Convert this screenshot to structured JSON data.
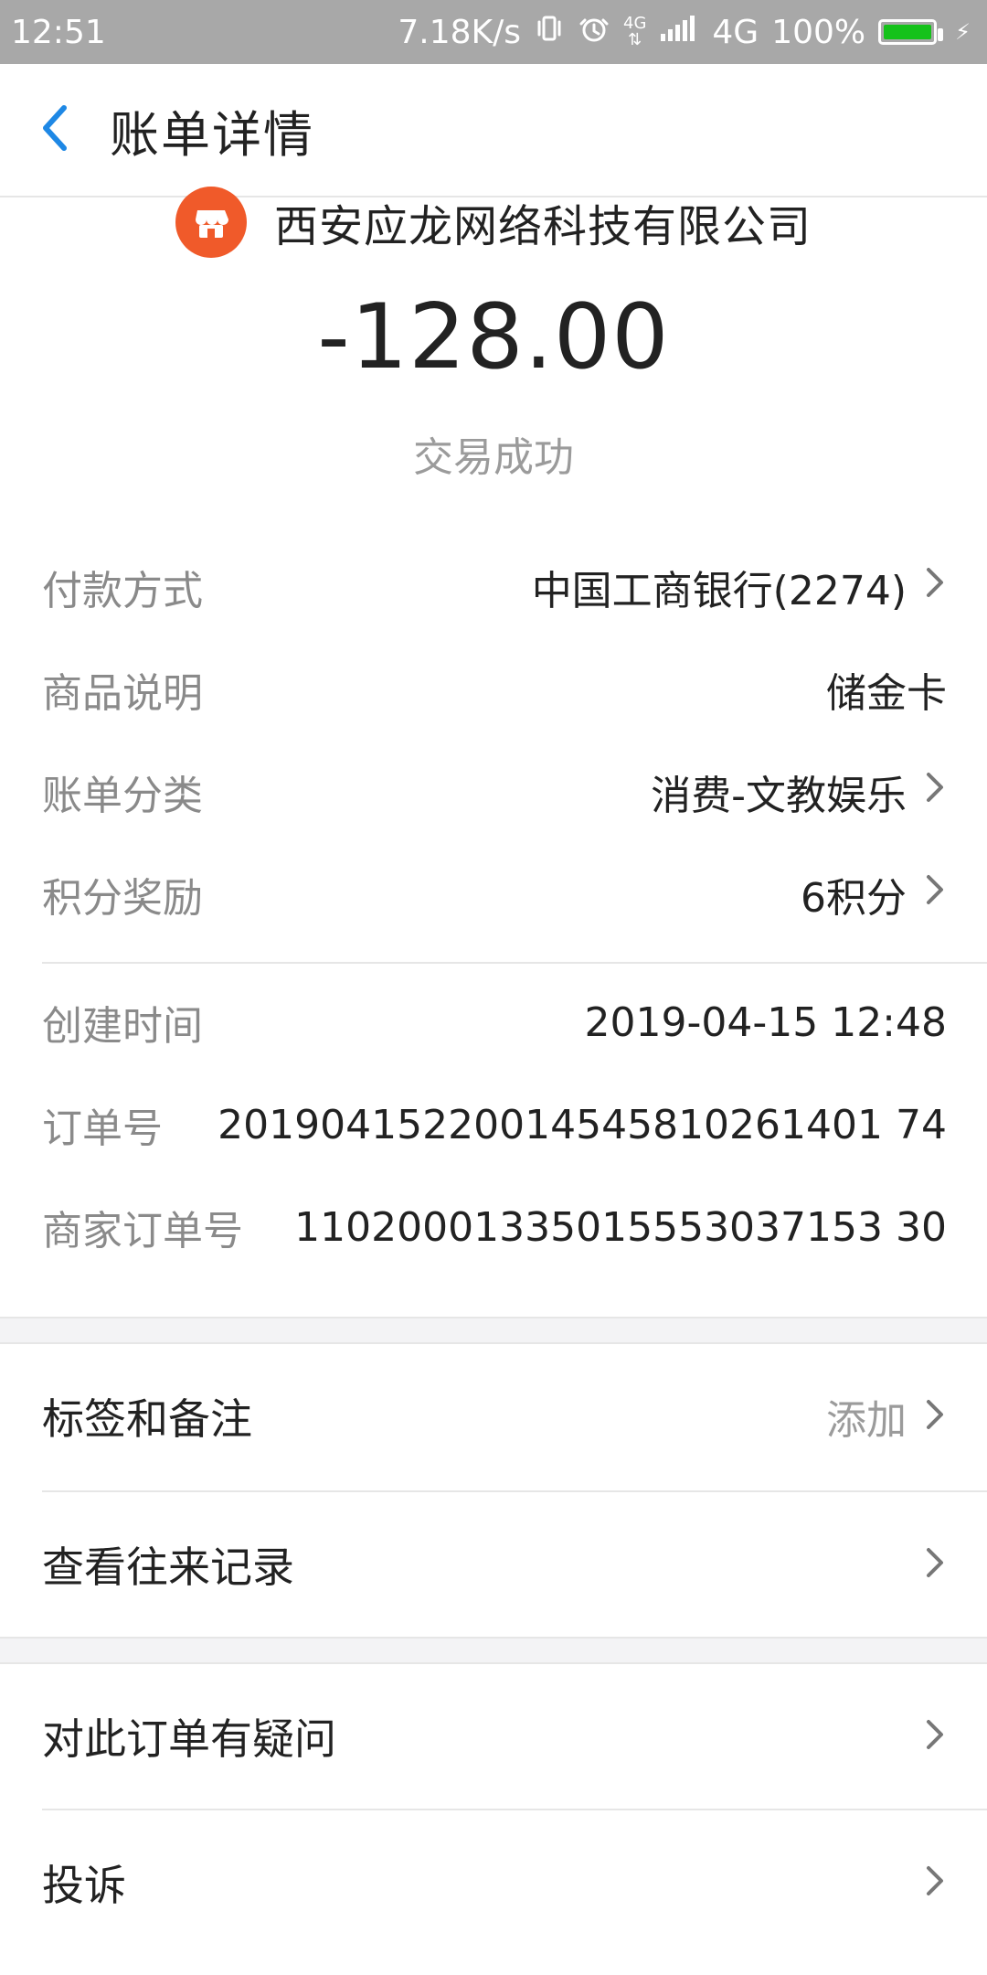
{
  "status_bar": {
    "time": "12:51",
    "network_speed": "7.18K/s",
    "small_4g": "4G",
    "network_type": "4G",
    "battery": "100%"
  },
  "header": {
    "title": "账单详情"
  },
  "merchant": {
    "name": "西安应龙网络科技有限公司",
    "amount": "-128.00",
    "status": "交易成功"
  },
  "details": [
    {
      "label": "付款方式",
      "value": "中国工商银行(2274)",
      "chevron": true
    },
    {
      "label": "商品说明",
      "value": "储金卡",
      "chevron": false
    },
    {
      "label": "账单分类",
      "value": "消费-文教娱乐",
      "chevron": true
    },
    {
      "label": "积分奖励",
      "value": "6积分",
      "chevron": true
    }
  ],
  "meta": [
    {
      "label": "创建时间",
      "value": "2019-04-15 12:48"
    },
    {
      "label": "订单号",
      "value": "20190415220014545810261401 74"
    },
    {
      "label": "商家订单号",
      "value": "11020001335015553037153 30"
    }
  ],
  "actions": {
    "tags": {
      "label": "标签和备注",
      "hint": "添加"
    },
    "history": {
      "label": "查看往来记录"
    },
    "question": {
      "label": "对此订单有疑问"
    },
    "complain": {
      "label": "投诉"
    }
  },
  "colors": {
    "accent_blue": "#1e88e5",
    "shop_orange": "#f05a2a",
    "battery_green": "#15c21a"
  }
}
